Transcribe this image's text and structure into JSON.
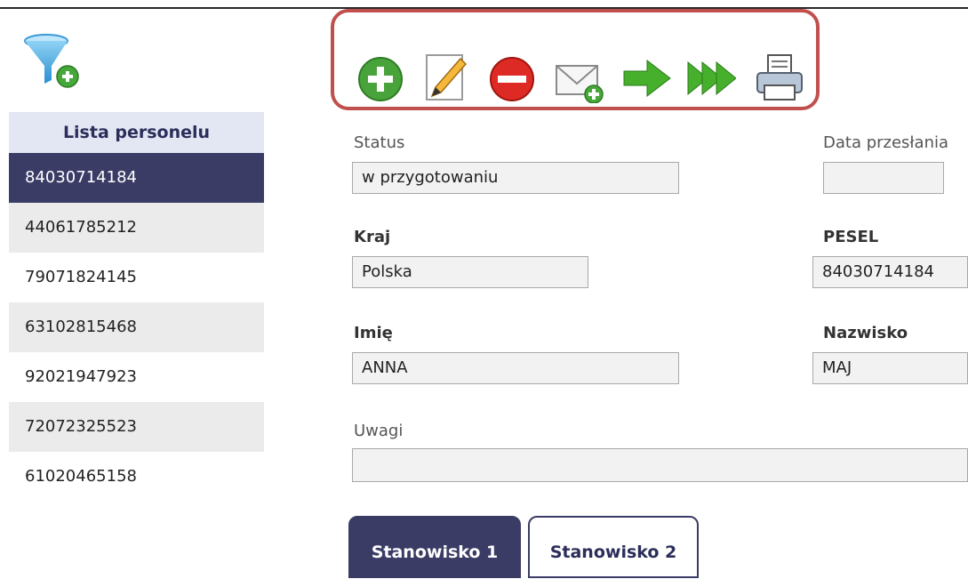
{
  "sidebar": {
    "title": "Lista personelu",
    "items": [
      {
        "label": "84030714184",
        "active": true
      },
      {
        "label": "44061785212"
      },
      {
        "label": "79071824145"
      },
      {
        "label": "63102815468"
      },
      {
        "label": "92021947923"
      },
      {
        "label": "72072325523"
      },
      {
        "label": "61020465158"
      }
    ]
  },
  "toolbar": {
    "buttons": [
      "add-icon",
      "edit-pencil-icon",
      "delete-icon",
      "send-mail-icon",
      "next-arrow-icon",
      "last-arrow-icon",
      "print-icon"
    ]
  },
  "form": {
    "status_label": "Status",
    "status_value": "w przygotowaniu",
    "data_przeslania_label": "Data przesłania",
    "data_przeslania_value": "",
    "kraj_label": "Kraj",
    "kraj_value": "Polska",
    "pesel_label": "PESEL",
    "pesel_value": "84030714184",
    "imie_label": "Imię",
    "imie_value": "ANNA",
    "nazwisko_label": "Nazwisko",
    "nazwisko_value": "MAJ",
    "uwagi_label": "Uwagi",
    "uwagi_value": ""
  },
  "tabs": [
    {
      "label": "Stanowisko 1",
      "active": true
    },
    {
      "label": "Stanowisko 2",
      "active": false
    }
  ],
  "colors": {
    "accent": "#3b3c66",
    "highlight_frame": "#c0504d",
    "header_bg": "#e3e6f3"
  }
}
